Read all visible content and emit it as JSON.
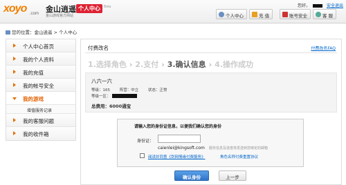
{
  "header": {
    "logo_text": "xoyo",
    "logo_domain": ".com",
    "brand": "金山逍遥",
    "brand_sub": "金山游戏官方网站",
    "center_tag": "个人中心",
    "beta": "Beta",
    "greeting": "您好，",
    "logout": "安全退出",
    "buttons": [
      {
        "label": "个人中心",
        "icon": "person-icon",
        "color": "#6a8fc2"
      },
      {
        "label": "充 值",
        "icon": "recharge-icon",
        "color": "#e8a020"
      },
      {
        "label": "账号安全",
        "icon": "lock-icon",
        "color": "#c33"
      },
      {
        "label": "客 服",
        "icon": "service-icon",
        "color": "#5a9"
      }
    ]
  },
  "breadcrumb": "您的位置：金山逍遥 > 个人中心",
  "sidebar": {
    "items": [
      {
        "label": "个人中心首页"
      },
      {
        "label": "我的个人资料"
      },
      {
        "label": "我的充值"
      },
      {
        "label": "我的帐号安全"
      },
      {
        "label": "我的游戏",
        "active": true
      },
      {
        "label": "我的客服问题"
      },
      {
        "label": "我的收件箱"
      }
    ],
    "sub_item": "增值服务记录"
  },
  "main": {
    "title": "付费改名",
    "faq": "付费改名FAQ",
    "steps": [
      "1.选择角色",
      "2.支付",
      "3.确认信息",
      "4.操作成功"
    ],
    "current_step": 2,
    "role": {
      "name": "八六一六",
      "level": "等级：165",
      "camp": "阵营：中立",
      "status": "状态：正常",
      "extra_label": "等级一区：",
      "fee": "总费用：6000通宝"
    },
    "verify": {
      "title": "请输入您的身份证信息，以便我们确认您的身份",
      "id_label": "身份证：",
      "id_value": "",
      "email": "caienlei@kingsoft.com",
      "email_note": "服务信息及进度将发送到您绑定的邮箱",
      "agree_link": "阅读并同意《剑网情缘付费服务》",
      "agree_note": "角色名称付费重置协议"
    },
    "buttons": {
      "confirm": "确认身份",
      "prev": "上一步"
    }
  },
  "colors": {
    "accent": "#e07000",
    "link": "#0066cc",
    "primary_button": "#2f74c8"
  }
}
